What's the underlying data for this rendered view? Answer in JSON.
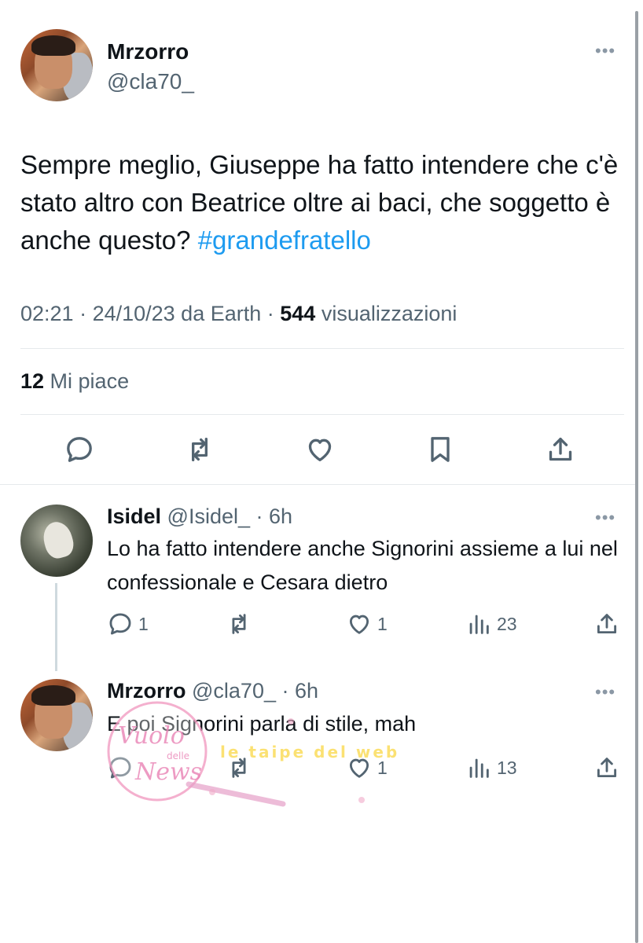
{
  "main_tweet": {
    "author_name": "Mrzorro",
    "author_handle": "@cla70_",
    "more_label": "•••",
    "text": "Sempre meglio, Giuseppe ha fatto intendere che c'è stato altro con Beatrice oltre ai baci, che soggetto è anche questo? ",
    "hashtag": "#grandefratello",
    "time": "02:21",
    "separator": " · ",
    "date_source": "24/10/23 da Earth",
    "views_count": "544",
    "views_label": " visualizzazioni",
    "likes_count": "12",
    "likes_label": " Mi piace",
    "actions": [
      "reply-icon",
      "retweet-icon",
      "like-icon",
      "bookmark-icon",
      "share-icon"
    ]
  },
  "replies": [
    {
      "author_name": "Isidel",
      "author_handle": " @Isidel_ · 6h",
      "more_label": "•••",
      "text": "Lo ha fatto intendere anche Signorini assieme a lui nel confessionale e Cesara dietro",
      "reply_count": "1",
      "retweet_count": "",
      "like_count": "1",
      "view_count": "23"
    },
    {
      "author_name": "Mrzorro",
      "author_handle": " @cla70_ · 6h",
      "more_label": "•••",
      "text": "E poi Signorini parla di stile, mah",
      "reply_count": "",
      "retweet_count": "",
      "like_count": "1",
      "view_count": "13"
    }
  ],
  "watermark": {
    "logo_text": "Vuolo delle News",
    "overlay_text": "le taipe del web"
  },
  "colors": {
    "text": "#0f1419",
    "secondary": "#536471",
    "link": "#1d9bf0",
    "divider": "#e6e9ec"
  }
}
